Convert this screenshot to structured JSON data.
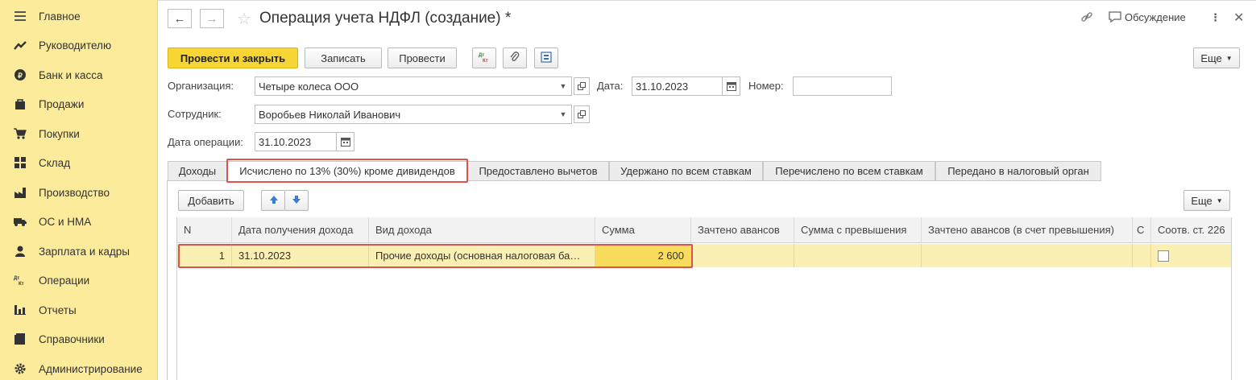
{
  "sidebar": {
    "items": [
      {
        "label": "Главное",
        "icon": "menu-icon"
      },
      {
        "label": "Руководителю",
        "icon": "trend-icon"
      },
      {
        "label": "Банк и касса",
        "icon": "coin-icon"
      },
      {
        "label": "Продажи",
        "icon": "bag-icon"
      },
      {
        "label": "Покупки",
        "icon": "cart-icon"
      },
      {
        "label": "Склад",
        "icon": "warehouse-icon"
      },
      {
        "label": "Производство",
        "icon": "factory-icon"
      },
      {
        "label": "ОС и НМА",
        "icon": "truck-icon"
      },
      {
        "label": "Зарплата и кадры",
        "icon": "person-icon"
      },
      {
        "label": "Операции",
        "icon": "dt-kt-icon"
      },
      {
        "label": "Отчеты",
        "icon": "bar-chart-icon"
      },
      {
        "label": "Справочники",
        "icon": "book-icon"
      },
      {
        "label": "Администрирование",
        "icon": "gear-icon"
      }
    ]
  },
  "header": {
    "title": "Операция учета НДФЛ (создание) *",
    "discussion_label": "Обсуждение"
  },
  "toolbar": {
    "post_close_label": "Провести и закрыть",
    "save_label": "Записать",
    "post_label": "Провести",
    "more_label": "Еще"
  },
  "form": {
    "org_label": "Организация:",
    "org_value": "Четыре колеса ООО",
    "date_label": "Дата:",
    "date_value": "31.10.2023",
    "number_label": "Номер:",
    "number_value": "",
    "employee_label": "Сотрудник:",
    "employee_value": "Воробьев Николай Иванович",
    "op_date_label": "Дата операции:",
    "op_date_value": "31.10.2023"
  },
  "tabs": [
    {
      "label": "Доходы"
    },
    {
      "label": "Исчислено по 13% (30%) кроме дивидендов"
    },
    {
      "label": "Предоставлено вычетов"
    },
    {
      "label": "Удержано по всем ставкам"
    },
    {
      "label": "Перечислено по всем ставкам"
    },
    {
      "label": "Передано в налоговый орган"
    }
  ],
  "table_toolbar": {
    "add_label": "Добавить",
    "more_label": "Еще"
  },
  "table": {
    "columns": [
      "N",
      "Дата получения дохода",
      "Вид дохода",
      "Сумма",
      "Зачтено авансов",
      "Сумма с превышения",
      "Зачтено авансов (в счет превышения)",
      "С",
      "Соотв. ст. 226"
    ],
    "rows": [
      {
        "n": "1",
        "date": "31.10.2023",
        "kind": "Прочие доходы (основная налоговая ба…",
        "sum": "2 600",
        "advances": "",
        "excess_sum": "",
        "excess_advances": "",
        "c": "",
        "art226": false
      }
    ]
  },
  "colors": {
    "sidebar_bg": "#fbeb9b",
    "primary_button": "#f7d532",
    "selected_row": "#fbf0b3",
    "highlight_border": "#d9534f"
  }
}
